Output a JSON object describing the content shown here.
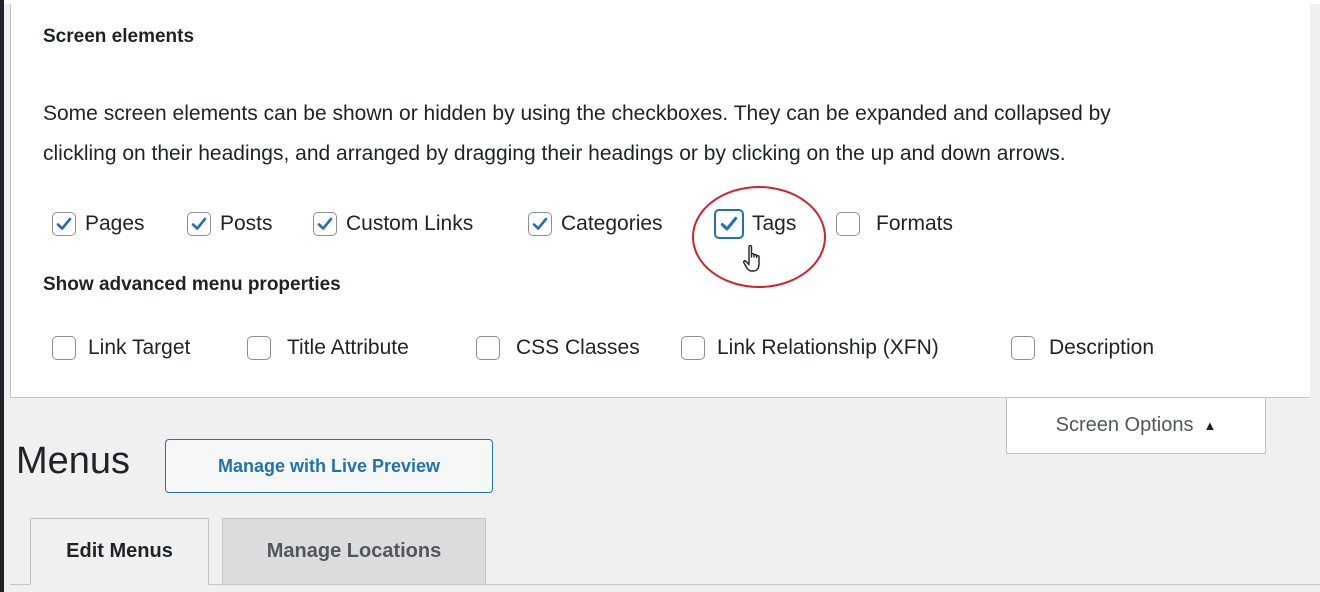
{
  "screen_options_panel": {
    "heading": "Screen elements",
    "description_line1": "Some screen elements can be shown or hidden by using the checkboxes. They can be expanded and collapsed by",
    "description_line2": "clickling on their headings, and arranged by dragging their headings or by clicking on the up and down arrows.",
    "elements": [
      {
        "label": "Pages",
        "checked": true
      },
      {
        "label": "Posts",
        "checked": true
      },
      {
        "label": "Custom Links",
        "checked": true
      },
      {
        "label": "Categories",
        "checked": true
      },
      {
        "label": "Tags",
        "checked": true,
        "highlighted": true
      },
      {
        "label": "Formats",
        "checked": false
      }
    ],
    "advanced_heading": "Show advanced menu properties",
    "advanced": [
      {
        "label": "Link Target",
        "checked": false
      },
      {
        "label": "Title Attribute",
        "checked": false
      },
      {
        "label": "CSS Classes",
        "checked": false
      },
      {
        "label": "Link Relationship (XFN)",
        "checked": false
      },
      {
        "label": "Description",
        "checked": false
      }
    ]
  },
  "screen_options_toggle": {
    "label": "Screen Options",
    "icon": "triangle-up-icon"
  },
  "page": {
    "title": "Menus",
    "live_preview_button": "Manage with Live Preview",
    "tabs": [
      {
        "label": "Edit Menus",
        "active": true
      },
      {
        "label": "Manage Locations",
        "active": false
      }
    ]
  },
  "colors": {
    "accent": "#2271b1",
    "annotation": "#d4202a",
    "background": "#f0f0f1",
    "panel": "#ffffff"
  },
  "annotation": {
    "type": "circle",
    "target": "Tags"
  },
  "cursor_icon": "hand-pointer-icon"
}
